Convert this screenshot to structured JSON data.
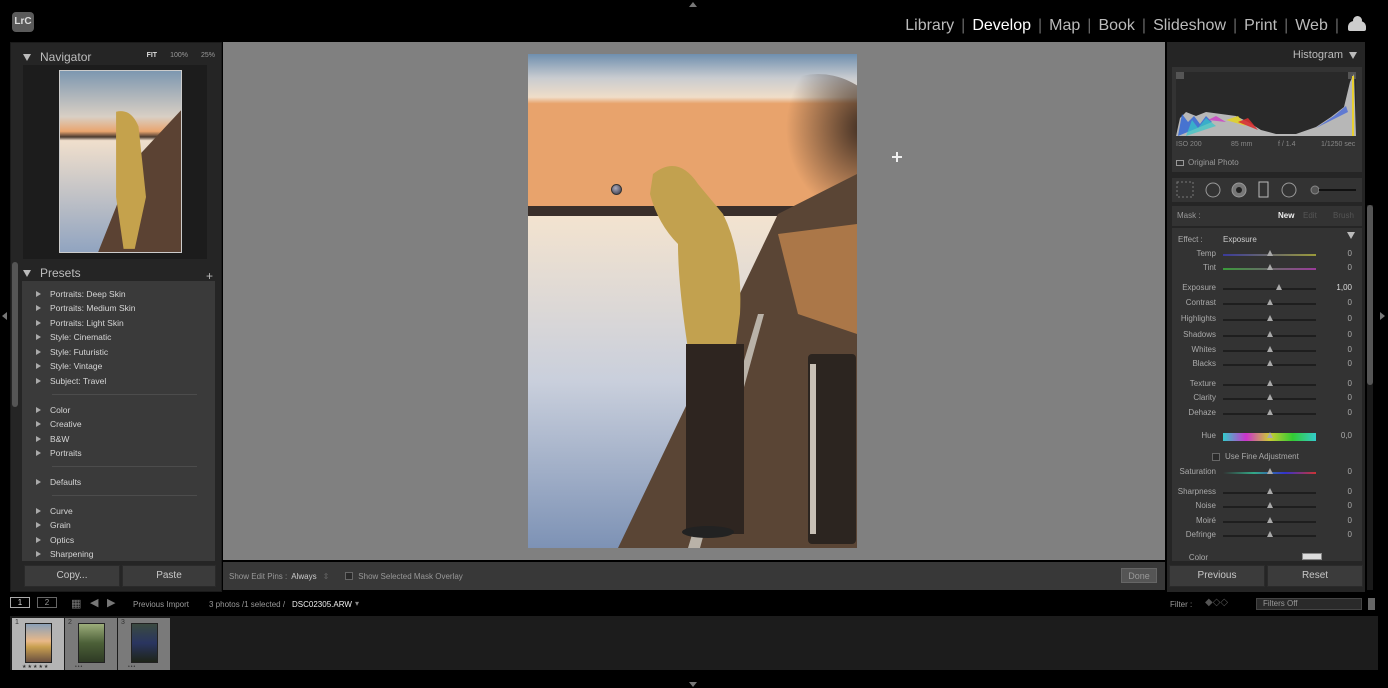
{
  "app": {
    "logo": "LrC"
  },
  "modules": [
    {
      "label": "Library",
      "active": false
    },
    {
      "label": "Develop",
      "active": true
    },
    {
      "label": "Map",
      "active": false
    },
    {
      "label": "Book",
      "active": false
    },
    {
      "label": "Slideshow",
      "active": false
    },
    {
      "label": "Print",
      "active": false
    },
    {
      "label": "Web",
      "active": false
    }
  ],
  "navigator": {
    "title": "Navigator",
    "zoom_options": [
      "FIT",
      "100%",
      "25%"
    ],
    "selected_zoom": "FIT"
  },
  "presets": {
    "title": "Presets",
    "groups": [
      [
        "Portraits: Deep Skin",
        "Portraits: Medium Skin",
        "Portraits: Light Skin",
        "Style: Cinematic",
        "Style: Futuristic",
        "Style: Vintage",
        "Subject: Travel"
      ],
      [
        "Color",
        "Creative",
        "B&W",
        "Portraits"
      ],
      [
        "Defaults"
      ],
      [
        "Curve",
        "Grain",
        "Optics",
        "Sharpening"
      ]
    ]
  },
  "left_buttons": {
    "copy": "Copy...",
    "paste": "Paste"
  },
  "toolbar": {
    "edit_pins_label": "Show Edit Pins :",
    "edit_pins_value": "Always",
    "mask_overlay_label": "Show Selected Mask Overlay",
    "mask_overlay_checked": false,
    "done_label": "Done"
  },
  "histogram": {
    "title": "Histogram",
    "iso": "ISO 200",
    "focal": "85 mm",
    "aperture": "f / 1.4",
    "shutter": "1/1250 sec",
    "original_photo_label": "Original Photo"
  },
  "mask": {
    "label": "Mask :",
    "new": "New",
    "edit": "Edit",
    "brush": "Brush"
  },
  "effect": {
    "label": "Effect :",
    "value": "Exposure"
  },
  "sliders": [
    {
      "name": "Temp",
      "value": "0",
      "position": 0.5
    },
    {
      "name": "Tint",
      "value": "0",
      "position": 0.5
    },
    {
      "name": "Exposure",
      "value": "1,00",
      "position": 0.6
    },
    {
      "name": "Contrast",
      "value": "0",
      "position": 0.5
    },
    {
      "name": "Highlights",
      "value": "0",
      "position": 0.5
    },
    {
      "name": "Shadows",
      "value": "0",
      "position": 0.5
    },
    {
      "name": "Whites",
      "value": "0",
      "position": 0.5
    },
    {
      "name": "Blacks",
      "value": "0",
      "position": 0.5
    },
    {
      "name": "Texture",
      "value": "0",
      "position": 0.5
    },
    {
      "name": "Clarity",
      "value": "0",
      "position": 0.5
    },
    {
      "name": "Dehaze",
      "value": "0",
      "position": 0.5
    },
    {
      "name": "Hue",
      "value": "0,0",
      "position": 0.5
    },
    {
      "name": "Saturation",
      "value": "0",
      "position": 0.5
    },
    {
      "name": "Sharpness",
      "value": "0",
      "position": 0.5
    },
    {
      "name": "Noise",
      "value": "0",
      "position": 0.5
    },
    {
      "name": "Moiré",
      "value": "0",
      "position": 0.5
    },
    {
      "name": "Defringe",
      "value": "0",
      "position": 0.5
    }
  ],
  "fine_adjustment_label": "Use Fine Adjustment",
  "color_label": "Color",
  "right_buttons": {
    "previous": "Previous",
    "reset": "Reset"
  },
  "filmstrip": {
    "view1": "1",
    "view2": "2",
    "source": "Previous Import",
    "count_text": "3 photos /1 selected /",
    "filename": "DSC02305.ARW",
    "filter_label": "Filter :",
    "filter_value": "Filters Off",
    "thumbs": [
      {
        "num": "1",
        "selected": true,
        "rating": "★★★★★"
      },
      {
        "num": "2",
        "selected": false,
        "rating": "•••"
      },
      {
        "num": "3",
        "selected": false,
        "rating": "•••"
      }
    ]
  }
}
